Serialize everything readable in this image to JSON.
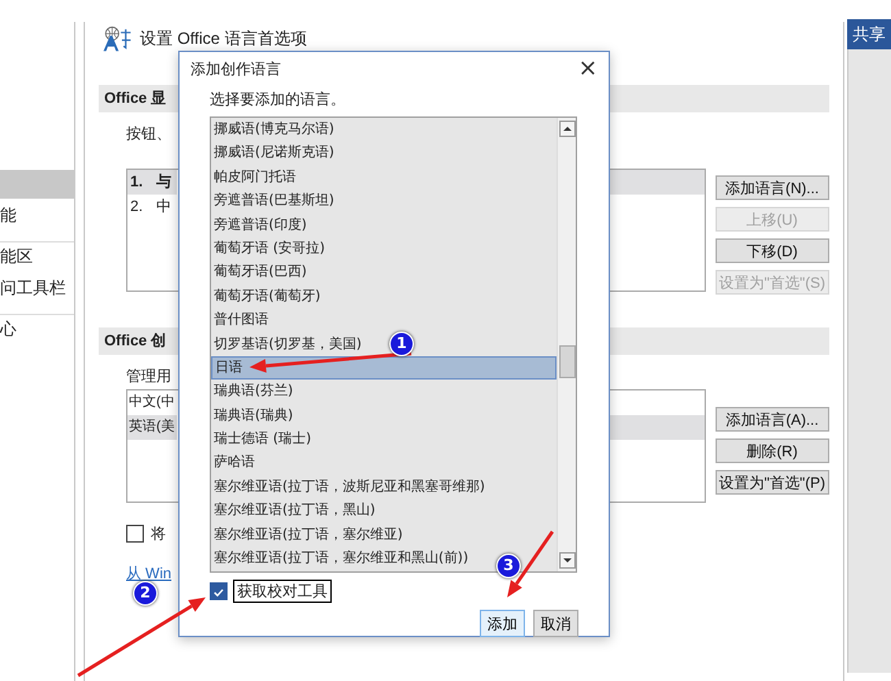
{
  "window": {
    "share_button": "共享"
  },
  "sidebar": {
    "groups": [
      {
        "items": [
          {
            "selected": true
          },
          {
            "label": "能",
            "selected": false
          }
        ]
      },
      {
        "items": [
          {
            "label": "能区",
            "selected": false
          },
          {
            "label": "问工具栏",
            "selected": false
          }
        ]
      },
      {
        "items": [
          {
            "label": "心",
            "selected": false
          }
        ]
      }
    ]
  },
  "panel": {
    "title": "设置 Office 语言首选项",
    "display_section": {
      "heading": "Office 显",
      "description": "按钮、",
      "languages": [
        {
          "number": "1.",
          "name": "与",
          "selected": true
        },
        {
          "number": "2.",
          "name": "中",
          "selected": false
        }
      ],
      "buttons": [
        {
          "label": "添加语言(N)...",
          "disabled": false
        },
        {
          "label": "上移(U)",
          "disabled": true
        },
        {
          "label": "下移(D)",
          "disabled": false
        },
        {
          "label": "设置为\"首选\"(S)",
          "disabled": true
        }
      ]
    },
    "authoring_section": {
      "heading": "Office 创",
      "description": "管理用",
      "languages": [
        {
          "name": "中文(中",
          "selected": false
        },
        {
          "name": "英语(美",
          "selected": true
        }
      ],
      "buttons": [
        {
          "label": "添加语言(A)...",
          "disabled": false
        },
        {
          "label": "删除(R)",
          "disabled": false
        },
        {
          "label": "设置为\"首选\"(P)",
          "disabled": false
        }
      ]
    },
    "checkbox": {
      "label": "将",
      "checked": false
    },
    "link": "从 Win"
  },
  "dialog": {
    "title": "添加创作语言",
    "close": "×",
    "prompt": "选择要添加的语言。",
    "languages": [
      {
        "name": "挪威语(博克马尔语)",
        "selected": false
      },
      {
        "name": "挪威语(尼诺斯克语)",
        "selected": false
      },
      {
        "name": "帕皮阿门托语",
        "selected": false
      },
      {
        "name": "旁遮普语(巴基斯坦)",
        "selected": false
      },
      {
        "name": "旁遮普语(印度)",
        "selected": false
      },
      {
        "name": "葡萄牙语 (安哥拉)",
        "selected": false
      },
      {
        "name": "葡萄牙语(巴西)",
        "selected": false
      },
      {
        "name": "葡萄牙语(葡萄牙)",
        "selected": false
      },
      {
        "name": "普什图语",
        "selected": false
      },
      {
        "name": "切罗基语(切罗基，美国)",
        "selected": false
      },
      {
        "name": "日语",
        "selected": true
      },
      {
        "name": "瑞典语(芬兰)",
        "selected": false
      },
      {
        "name": "瑞典语(瑞典)",
        "selected": false
      },
      {
        "name": "瑞士德语 (瑞士)",
        "selected": false
      },
      {
        "name": "萨哈语",
        "selected": false
      },
      {
        "name": "塞尔维亚语(拉丁语，波斯尼亚和黑塞哥维那)",
        "selected": false
      },
      {
        "name": "塞尔维亚语(拉丁语，黑山)",
        "selected": false
      },
      {
        "name": "塞尔维亚语(拉丁语，塞尔维亚)",
        "selected": false
      },
      {
        "name": "塞尔维亚语(拉丁语，塞尔维亚和黑山(前))",
        "selected": false
      }
    ],
    "checkbox": {
      "label": "获取校对工具",
      "checked": true
    },
    "buttons": [
      {
        "label": "添加",
        "default": true
      },
      {
        "label": "取消",
        "default": false
      }
    ]
  },
  "annotations": [
    {
      "number": "1"
    },
    {
      "number": "2"
    },
    {
      "number": "3"
    }
  ]
}
